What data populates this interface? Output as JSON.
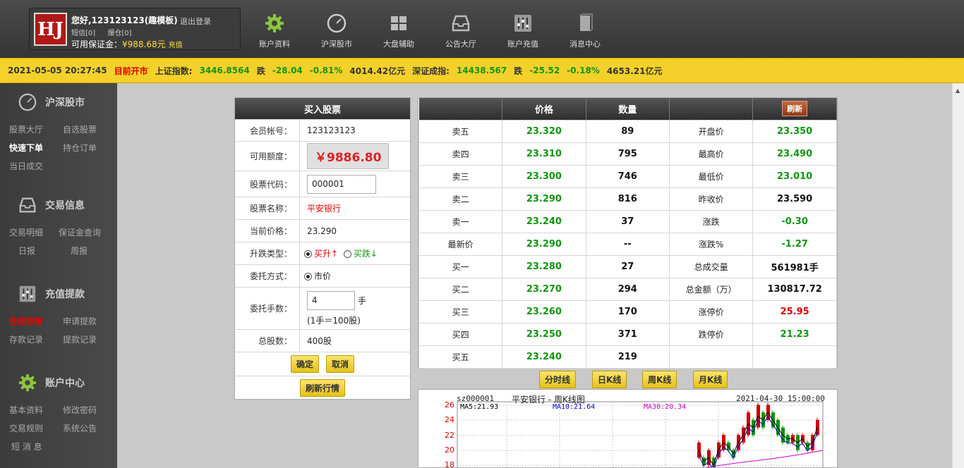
{
  "header": {
    "greeting": "您好,123123123(趣模板)",
    "logout": "退出登录",
    "sms": "短信[0]",
    "warehouse": "爆仓[0]",
    "margin_label": "可用保证金：",
    "margin_value": "¥988.68元",
    "recharge": "充值",
    "logo_text": "HJ",
    "nav": [
      {
        "label": "账户资料",
        "icon": "gear-icon"
      },
      {
        "label": "沪深股市",
        "icon": "gauge-icon"
      },
      {
        "label": "大盘辅助",
        "icon": "grid-icon"
      },
      {
        "label": "公告大厅",
        "icon": "inbox-icon"
      },
      {
        "label": "账户充值",
        "icon": "sliders-icon"
      },
      {
        "label": "消息中心",
        "icon": "book-icon"
      }
    ]
  },
  "ticker": {
    "datetime": "2021-05-05 20:27:45",
    "status": "目前开市",
    "sh_label": "上证指数:",
    "sh_value": "3446.8564",
    "sh_dir": "跌",
    "sh_change": "-28.04",
    "sh_pct": "-0.81%",
    "sh_amount": "4014.42亿元",
    "sz_label": "深证成指:",
    "sz_value": "14438.567",
    "sz_dir": "跌",
    "sz_change": "-25.52",
    "sz_pct": "-0.18%",
    "sz_amount": "4653.21亿元"
  },
  "sidebar": {
    "sections": [
      {
        "title": "沪深股市",
        "icon": "gauge-icon",
        "links": [
          "股票大厅",
          "自选股票",
          "快速下单",
          "持仓订单",
          "当日成交"
        ]
      },
      {
        "title": "交易信息",
        "icon": "inbox-icon",
        "links": [
          "交易明细",
          "保证金查询",
          "日报",
          "周报"
        ]
      },
      {
        "title": "充值提款",
        "icon": "sliders-icon",
        "links": [
          "在线存款",
          "申请提款",
          "存款记录",
          "提款记录"
        ]
      },
      {
        "title": "账户中心",
        "icon": "gear-icon",
        "links": [
          "基本资料",
          "修改密码",
          "交易规则",
          "系统公告",
          "短 消 息"
        ]
      }
    ]
  },
  "buy": {
    "title": "买入股票",
    "account_label": "会员帐号：",
    "account": "123123123",
    "limit_label": "可用额度：",
    "limit": "￥9886.80",
    "code_label": "股票代码：",
    "code": "000001",
    "name_label": "股票名称：",
    "name": "平安银行",
    "price_label": "当前价格：",
    "price": "23.290",
    "type_label": "升跌类型：",
    "type_up": "买升↑",
    "type_down": "买跌↓",
    "order_label": "委托方式：",
    "order_type": "市价",
    "lots_label": "委托手数：",
    "lots": "4",
    "lots_unit": "手",
    "lots_note": "(1手＝100股)",
    "total_label": "总股数：",
    "total": "400股",
    "confirm": "确定",
    "cancel": "取消",
    "refresh": "刷新行情"
  },
  "quote": {
    "col_price": "价格",
    "col_qty": "数量",
    "refresh": "刷新",
    "rows": [
      {
        "label": "卖五",
        "price": "23.320",
        "qty": "89",
        "k": "开盘价",
        "v": "23.350",
        "vc": "p"
      },
      {
        "label": "卖四",
        "price": "23.310",
        "qty": "795",
        "k": "最高价",
        "v": "23.490",
        "vc": "p"
      },
      {
        "label": "卖三",
        "price": "23.300",
        "qty": "746",
        "k": "最低价",
        "v": "23.010",
        "vc": "p"
      },
      {
        "label": "卖二",
        "price": "23.290",
        "qty": "816",
        "k": "昨收价",
        "v": "23.590",
        "vc": "k"
      },
      {
        "label": "卖一",
        "price": "23.240",
        "qty": "37",
        "k": "涨跌",
        "v": "-0.30",
        "vc": "p"
      },
      {
        "label": "最新价",
        "price": "23.290",
        "qty": "--",
        "k": "涨跌%",
        "v": "-1.27",
        "vc": "p"
      },
      {
        "label": "买一",
        "price": "23.280",
        "qty": "27",
        "k": "总成交量",
        "v": "561981手",
        "vc": "k"
      },
      {
        "label": "买二",
        "price": "23.270",
        "qty": "294",
        "k": "总金额（万）",
        "v": "130817.72",
        "vc": "k"
      },
      {
        "label": "买三",
        "price": "23.260",
        "qty": "170",
        "k": "涨停价",
        "v": "25.95",
        "vc": "r"
      },
      {
        "label": "买四",
        "price": "23.250",
        "qty": "371",
        "k": "跌停价",
        "v": "21.23",
        "vc": "p"
      },
      {
        "label": "买五",
        "price": "23.240",
        "qty": "219",
        "k": "",
        "v": "",
        "vc": "k"
      }
    ]
  },
  "kline_buttons": [
    "分时线",
    "日K线",
    "周K线",
    "月K线"
  ],
  "kchart": {
    "code": "sz000001",
    "title": "平安银行 - 周K线图",
    "date": "2021-04-30 15:00:00",
    "ma5": "MA5:21.93",
    "ma10": "MA10:21.64",
    "ma30": "MA30:20.34",
    "y_ticks": [
      "26",
      "24",
      "22",
      "20",
      "18"
    ],
    "colors": {
      "ma5": "#000000",
      "ma10": "#0000cc",
      "ma30": "#cc00cc",
      "up": "#d00000",
      "down": "#119411"
    }
  }
}
